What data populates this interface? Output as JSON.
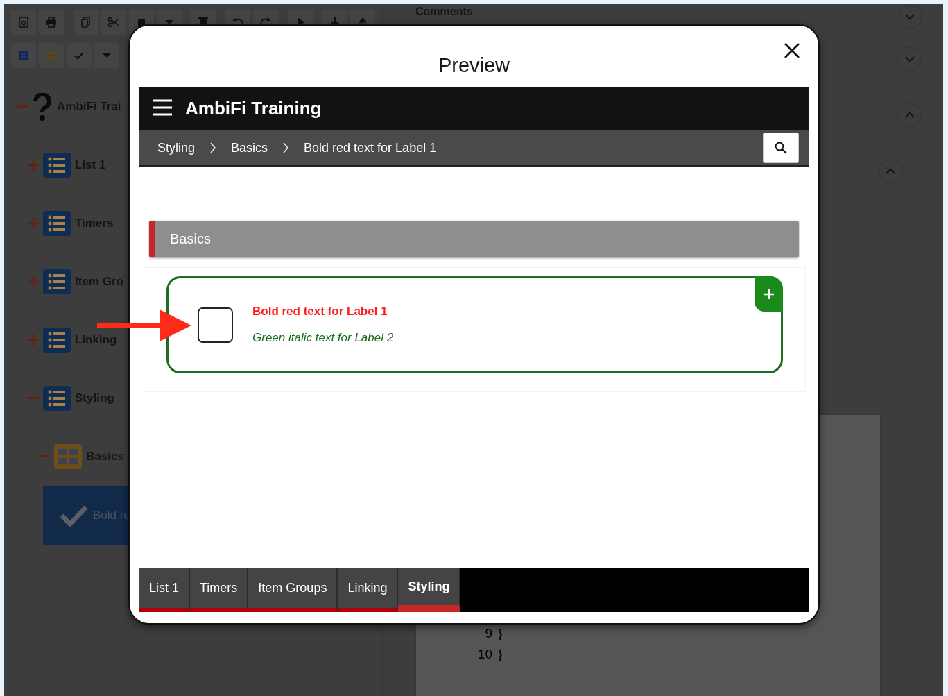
{
  "tree": [
    {
      "label": "AmbiFi Trai",
      "kind": "root",
      "expanded": true,
      "selected": false,
      "children": [
        {
          "label": "List 1",
          "kind": "list",
          "expanded": false,
          "selected": false
        },
        {
          "label": "Timers",
          "kind": "list",
          "expanded": false,
          "selected": false
        },
        {
          "label": "Item Gro",
          "kind": "list",
          "expanded": false,
          "selected": false
        },
        {
          "label": "Linking",
          "kind": "list",
          "expanded": false,
          "selected": false
        },
        {
          "label": "Styling",
          "kind": "list",
          "expanded": true,
          "selected": false,
          "children": [
            {
              "label": "Basics",
              "kind": "group",
              "expanded": true,
              "selected": false,
              "children": [
                {
                  "label": "Bold re",
                  "kind": "check",
                  "selected": true
                }
              ]
            }
          ]
        }
      ]
    }
  ],
  "side_sections": [
    {
      "label": "Comments",
      "expanded": false
    },
    {
      "expanded": false
    },
    {
      "expanded": true
    },
    {
      "expanded": true
    }
  ],
  "code_lines": [
    {
      "number": "9",
      "text": "}"
    },
    {
      "number": "10",
      "text": "}"
    }
  ],
  "preview": {
    "title": "Preview",
    "app_title": "AmbiFi Training",
    "breadcrumb": [
      "Styling",
      "Basics",
      "Bold red text for Label 1"
    ],
    "section_title": "Basics",
    "card": {
      "checked": false,
      "labels": [
        {
          "text": "Bold red text for Label 1",
          "kind": "bold-red"
        },
        {
          "text": "Green italic text for Label 2",
          "kind": "green-italic"
        }
      ]
    },
    "tabs": [
      {
        "label": "List 1",
        "selected": false
      },
      {
        "label": "Timers",
        "selected": false
      },
      {
        "label": "Item Groups",
        "selected": false
      },
      {
        "label": "Linking",
        "selected": false
      },
      {
        "label": "Styling",
        "selected": true
      }
    ]
  }
}
